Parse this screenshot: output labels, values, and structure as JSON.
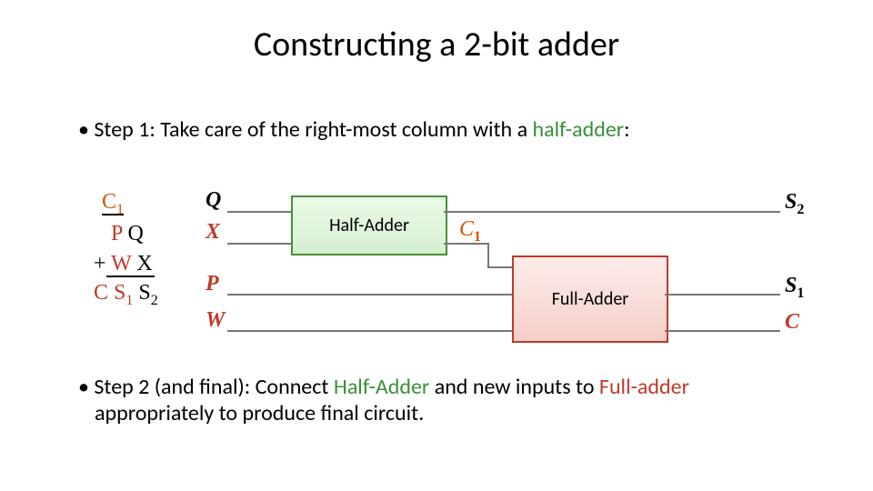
{
  "title": "Constructing a 2-bit adder",
  "step1": {
    "prefix": "Step 1: Take care of the right-most column with a ",
    "half": "half-adder",
    "suffix": ":"
  },
  "mathblock": {
    "c1": "C",
    "c1sub": "1",
    "p": "P",
    "q": "Q",
    "plus": "+",
    "w": "W",
    "x": "X",
    "c": "C",
    "s1": "S",
    "s1sub": "1",
    "s2": "S",
    "s2sub": "2"
  },
  "diagram": {
    "Q": "Q",
    "X": "X",
    "P": "P",
    "W": "W",
    "C1": "C",
    "C1sub": "1",
    "S2": "S",
    "S2sub": "2",
    "S1": "S",
    "S1sub": "1",
    "Cout": "C",
    "half_label": "Half-Adder",
    "full_label": "Full-Adder"
  },
  "step2": {
    "prefix": "Step 2 (and final): Connect ",
    "half": "Half-Adder",
    "mid": " and new inputs to ",
    "full": "Full-adder",
    "line2": "appropriately to produce final circuit."
  },
  "chart_data": {
    "type": "diagram",
    "purpose": "2-bit ripple-carry adder construction",
    "blocks": [
      {
        "name": "Half-Adder",
        "inputs": [
          "Q",
          "X"
        ],
        "outputs": [
          "S2",
          "C1"
        ]
      },
      {
        "name": "Full-Adder",
        "inputs": [
          "C1",
          "P",
          "W"
        ],
        "outputs": [
          "S1",
          "C"
        ]
      }
    ],
    "math": {
      "operands": [
        [
          "P",
          "Q"
        ],
        [
          "W",
          "X"
        ]
      ],
      "carry_in_to_col1": "C1",
      "result": [
        "C",
        "S1",
        "S2"
      ]
    }
  }
}
